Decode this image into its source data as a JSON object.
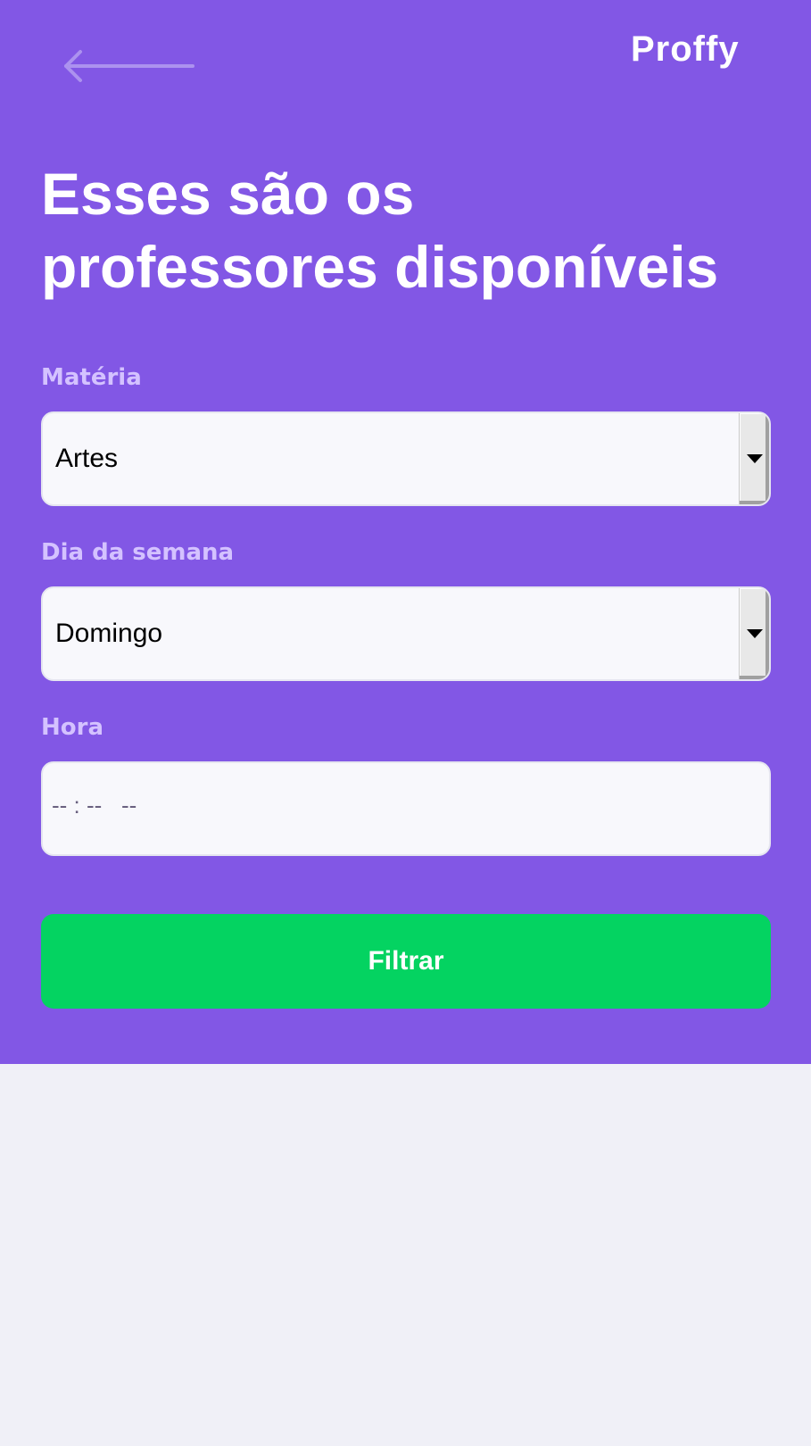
{
  "brand": {
    "name": "Proffy",
    "primary_color": "#8257e5",
    "success_color": "#04d361",
    "background_color": "#f0f0f7"
  },
  "header": {
    "back_icon": "arrow-left-icon",
    "title_line_1": "Esses são os",
    "title_line_2": "professores disponíveis"
  },
  "filters": {
    "subject": {
      "label": "Matéria",
      "value": "Artes"
    },
    "week_day": {
      "label": "Dia da semana",
      "value": "Domingo"
    },
    "time": {
      "label": "Hora",
      "value": "-- : --   --"
    },
    "submit_label": "Filtrar"
  }
}
